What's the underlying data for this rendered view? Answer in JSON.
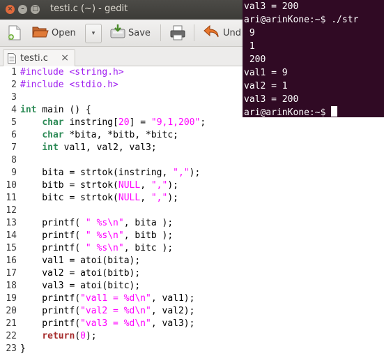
{
  "window": {
    "title": "testi.c (~) - gedit"
  },
  "toolbar": {
    "open_label": "Open",
    "save_label": "Save",
    "undo_label": "Und"
  },
  "tab": {
    "label": "testi.c",
    "close": "×"
  },
  "editor": {
    "line_numbers": [
      "1",
      "2",
      "3",
      "4",
      "5",
      "6",
      "7",
      "8",
      "9",
      "10",
      "11",
      "12",
      "13",
      "14",
      "15",
      "16",
      "17",
      "18",
      "19",
      "20",
      "21",
      "22",
      "23"
    ],
    "lines": [
      [
        {
          "t": "#include <string.h>",
          "c": "pp"
        }
      ],
      [
        {
          "t": "#include <stdio.h>",
          "c": "pp"
        }
      ],
      [
        {
          "t": "",
          "c": ""
        }
      ],
      [
        {
          "t": "int",
          "c": "ty"
        },
        {
          "t": " main () {",
          "c": ""
        }
      ],
      [
        {
          "t": "    ",
          "c": ""
        },
        {
          "t": "char",
          "c": "ty"
        },
        {
          "t": " instring[",
          "c": ""
        },
        {
          "t": "20",
          "c": "nu"
        },
        {
          "t": "] = ",
          "c": ""
        },
        {
          "t": "\"9,1,200\"",
          "c": "st"
        },
        {
          "t": ";",
          "c": ""
        }
      ],
      [
        {
          "t": "    ",
          "c": ""
        },
        {
          "t": "char",
          "c": "ty"
        },
        {
          "t": " *bita, *bitb, *bitc;",
          "c": ""
        }
      ],
      [
        {
          "t": "    ",
          "c": ""
        },
        {
          "t": "int",
          "c": "ty"
        },
        {
          "t": " val1, val2, val3;",
          "c": ""
        }
      ],
      [
        {
          "t": "",
          "c": ""
        }
      ],
      [
        {
          "t": "    bita = strtok(instring, ",
          "c": ""
        },
        {
          "t": "\",\"",
          "c": "st"
        },
        {
          "t": ");",
          "c": ""
        }
      ],
      [
        {
          "t": "    bitb = strtok(",
          "c": ""
        },
        {
          "t": "NULL",
          "c": "cn"
        },
        {
          "t": ", ",
          "c": ""
        },
        {
          "t": "\",\"",
          "c": "st"
        },
        {
          "t": ");",
          "c": ""
        }
      ],
      [
        {
          "t": "    bitc = strtok(",
          "c": ""
        },
        {
          "t": "NULL",
          "c": "cn"
        },
        {
          "t": ", ",
          "c": ""
        },
        {
          "t": "\",\"",
          "c": "st"
        },
        {
          "t": ");",
          "c": ""
        }
      ],
      [
        {
          "t": "",
          "c": ""
        }
      ],
      [
        {
          "t": "    printf( ",
          "c": ""
        },
        {
          "t": "\" %s\\n\"",
          "c": "st"
        },
        {
          "t": ", bita );",
          "c": ""
        }
      ],
      [
        {
          "t": "    printf( ",
          "c": ""
        },
        {
          "t": "\" %s\\n\"",
          "c": "st"
        },
        {
          "t": ", bitb );",
          "c": ""
        }
      ],
      [
        {
          "t": "    printf( ",
          "c": ""
        },
        {
          "t": "\" %s\\n\"",
          "c": "st"
        },
        {
          "t": ", bitc );",
          "c": ""
        }
      ],
      [
        {
          "t": "    val1 = atoi(bita);",
          "c": ""
        }
      ],
      [
        {
          "t": "    val2 = atoi(bitb);",
          "c": ""
        }
      ],
      [
        {
          "t": "    val3 = atoi(bitc);",
          "c": ""
        }
      ],
      [
        {
          "t": "    printf(",
          "c": ""
        },
        {
          "t": "\"val1 = %d\\n\"",
          "c": "st"
        },
        {
          "t": ", val1);",
          "c": ""
        }
      ],
      [
        {
          "t": "    printf(",
          "c": ""
        },
        {
          "t": "\"val2 = %d\\n\"",
          "c": "st"
        },
        {
          "t": ", val2);",
          "c": ""
        }
      ],
      [
        {
          "t": "    printf(",
          "c": ""
        },
        {
          "t": "\"val3 = %d\\n\"",
          "c": "st"
        },
        {
          "t": ", val3);",
          "c": ""
        }
      ],
      [
        {
          "t": "    ",
          "c": ""
        },
        {
          "t": "return",
          "c": "kw"
        },
        {
          "t": "(",
          "c": ""
        },
        {
          "t": "0",
          "c": "nu"
        },
        {
          "t": ");",
          "c": ""
        }
      ],
      [
        {
          "t": "}",
          "c": ""
        }
      ]
    ]
  },
  "terminal": {
    "lines": [
      "val3 = 200",
      "ari@arinKone:~$ ./str",
      " 9",
      " 1",
      " 200",
      "val1 = 9",
      "val2 = 1",
      "val3 = 200"
    ],
    "prompt": "ari@arinKone:~$ "
  },
  "colors": {
    "terminal_bg": "#300a24",
    "preprocessor": "#a020f0",
    "type": "#2e8b57",
    "keyword": "#a52a2a",
    "string": "#ff00ff"
  },
  "icons": [
    "close-icon",
    "minimize-icon",
    "maximize-icon",
    "new-document-icon",
    "open-folder-icon",
    "dropdown-arrow-icon",
    "save-icon",
    "print-icon",
    "undo-icon",
    "text-file-icon"
  ]
}
